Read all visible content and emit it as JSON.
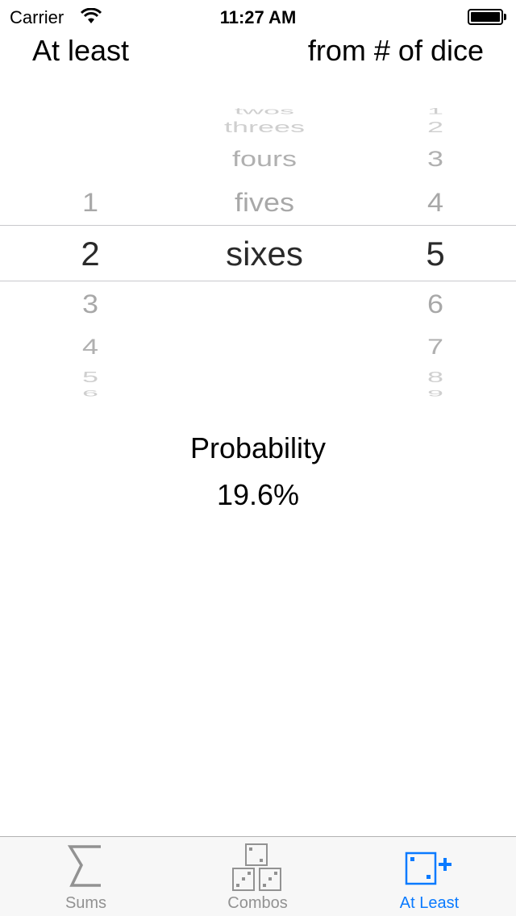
{
  "status": {
    "carrier": "Carrier",
    "time": "11:27 AM",
    "wifi_icon": "wifi-icon",
    "battery_icon": "battery-icon"
  },
  "header": {
    "left": "At least",
    "right": "from # of dice"
  },
  "picker": {
    "count_column": {
      "items": [
        "1",
        "2",
        "3",
        "4",
        "5",
        "6"
      ],
      "selected": "2"
    },
    "face_column": {
      "items": [
        "twos",
        "threes",
        "fours",
        "fives",
        "sixes"
      ],
      "selected": "sixes"
    },
    "dice_column": {
      "items": [
        "1",
        "2",
        "3",
        "4",
        "5",
        "6",
        "7",
        "8",
        "9"
      ],
      "selected": "5"
    }
  },
  "result": {
    "label": "Probability",
    "value": "19.6%"
  },
  "tabs": [
    {
      "label": "Sums",
      "icon": "sigma-icon"
    },
    {
      "label": "Combos",
      "icon": "dice-stack-icon"
    },
    {
      "label": "At Least",
      "icon": "die-plus-icon",
      "active": true
    }
  ],
  "colors": {
    "accent": "#0a7aff",
    "inactive": "#929292"
  }
}
